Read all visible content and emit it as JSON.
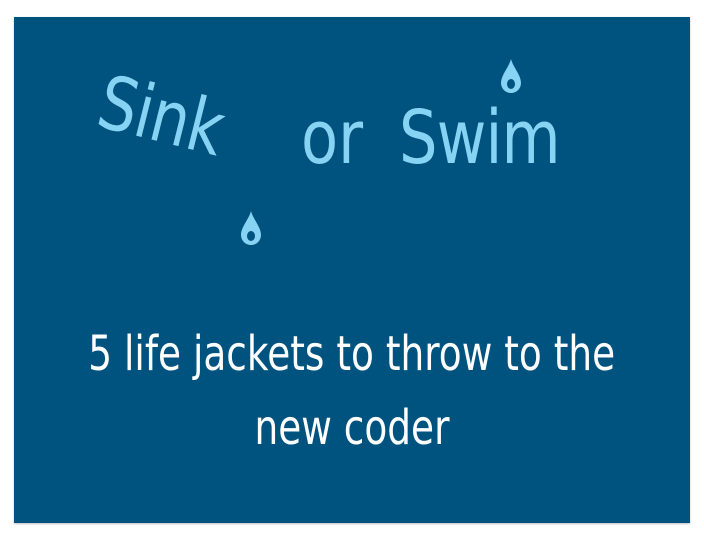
{
  "slide": {
    "title": {
      "word1": "Sink",
      "word2": "or",
      "word3": "Swim"
    },
    "subtitle": {
      "line1": "5 life jackets to throw to the",
      "line2": "new coder"
    },
    "colors": {
      "background": "#00537f",
      "title": "#86d3f3",
      "subtitle": "#ffffff"
    },
    "icons": [
      "water-drop-icon",
      "water-drop-icon"
    ]
  }
}
